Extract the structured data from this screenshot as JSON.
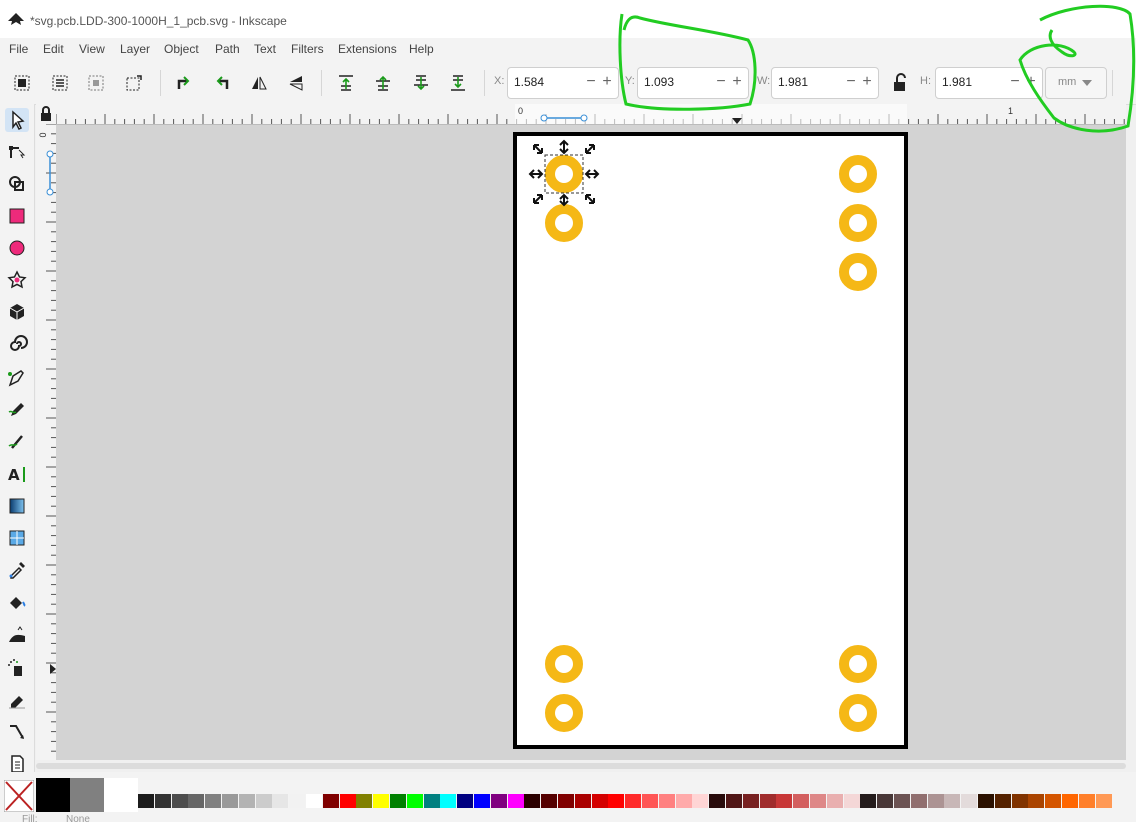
{
  "window": {
    "title": "*svg.pcb.LDD-300-1000H_1_pcb.svg - Inkscape"
  },
  "menu": [
    "File",
    "Edit",
    "View",
    "Layer",
    "Object",
    "Path",
    "Text",
    "Filters",
    "Extensions",
    "Help"
  ],
  "toolbar": {
    "x_label": "X:",
    "x_value": "1.584",
    "y_label": "Y:",
    "y_value": "1.093",
    "w_label": "W:",
    "w_value": "1.981",
    "h_label": "H:",
    "h_value": "1.981",
    "unit": "mm"
  },
  "ruler": {
    "top_labels": [
      "0",
      "1"
    ],
    "left_labels": [
      "0"
    ]
  },
  "status": {
    "fill_label": "Fill:",
    "fill_value": "None"
  },
  "colors": {
    "pad": "#f5b816",
    "board_border": "#000000",
    "canvas": "#d3d3d3",
    "annotation": "#22cc22",
    "active_tool": "#d3e4f5"
  },
  "palette": [
    "#1c1c1c",
    "#333333",
    "#4d4d4d",
    "#666666",
    "#808080",
    "#999999",
    "#b3b3b3",
    "#cccccc",
    "#e6e6e6",
    "#f2f2f2",
    "#ffffff",
    "#800000",
    "#ff0000",
    "#808000",
    "#ffff00",
    "#008000",
    "#00ff00",
    "#008080",
    "#00ffff",
    "#000080",
    "#0000ff",
    "#800080",
    "#ff00ff",
    "#2b0000",
    "#550000",
    "#800000",
    "#aa0000",
    "#d40000",
    "#ff0000",
    "#ff2a2a",
    "#ff5555",
    "#ff8080",
    "#ffaaaa",
    "#ffd5d5",
    "#280b0b",
    "#501616",
    "#782121",
    "#a02c2c",
    "#c83737",
    "#d35f5f",
    "#de8787",
    "#e9afaf",
    "#f4d7d7",
    "#241c1c",
    "#483737",
    "#6c5353",
    "#916f6f",
    "#ac9393",
    "#c8b7b7",
    "#e3dbdb",
    "#2b1100",
    "#552200",
    "#803300",
    "#aa4400",
    "#d45500",
    "#ff6600",
    "#ff7f2a",
    "#ff9955"
  ]
}
